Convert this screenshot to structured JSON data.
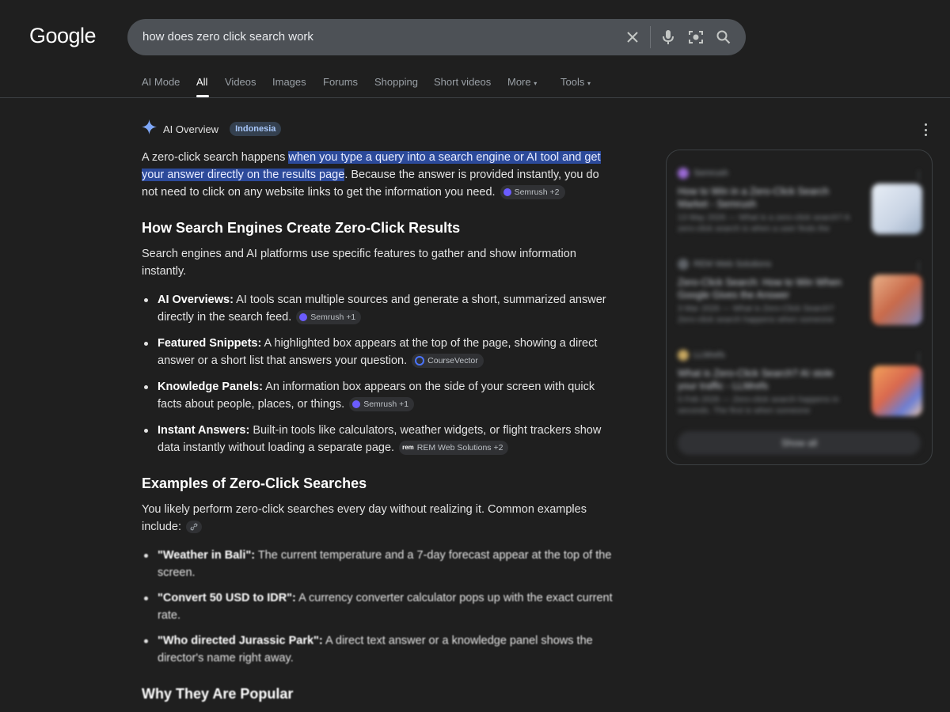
{
  "header": {
    "logo": "Google",
    "search_query": "how does zero click search work"
  },
  "tabs": [
    {
      "label": "AI Mode"
    },
    {
      "label": "All"
    },
    {
      "label": "Videos"
    },
    {
      "label": "Images"
    },
    {
      "label": "Forums"
    },
    {
      "label": "Shopping"
    },
    {
      "label": "Short videos"
    },
    {
      "label": "More"
    },
    {
      "label": "Tools"
    }
  ],
  "ai_overview": {
    "title": "AI Overview",
    "badge": "Indonesia",
    "intro_pre": "A zero-click search happens ",
    "intro_highlight": "when you type a query into a search engine or AI tool and get your answer directly on the results page",
    "intro_post": ". Because the answer is provided instantly, you do not need to click on any website links to get the information you need.",
    "intro_cite": "Semrush +2",
    "section1": {
      "heading": "How Search Engines Create Zero-Click Results",
      "lead": "Search engines and AI platforms use specific features to gather and show information instantly.",
      "items": [
        {
          "term": "AI Overviews:",
          "text": " AI tools scan multiple sources and generate a short, summarized answer directly in the search feed.",
          "cite": "Semrush +1"
        },
        {
          "term": "Featured Snippets:",
          "text": " A highlighted box appears at the top of the page, showing a direct answer or a short list that answers your question.",
          "cite": "CourseVector"
        },
        {
          "term": "Knowledge Panels:",
          "text": " An information box appears on the side of your screen with quick facts about people, places, or things.",
          "cite": "Semrush +1"
        },
        {
          "term": "Instant Answers:",
          "text": " Built-in tools like calculators, weather widgets, or flight trackers show data instantly without loading a separate page.",
          "cite": "REM Web Solutions +2"
        }
      ]
    },
    "section2": {
      "heading": "Examples of Zero-Click Searches",
      "lead": "You likely perform zero-click searches every day without realizing it. Common examples include:",
      "items": [
        {
          "term": "\"Weather in Bali\":",
          "text": " The current temperature and a 7-day forecast appear at the top of the screen."
        },
        {
          "term": "\"Convert 50 USD to IDR\":",
          "text": " A currency converter calculator pops up with the exact current rate."
        },
        {
          "term": "\"Who directed Jurassic Park\":",
          "text": " A direct text answer or a knowledge panel shows the director's name right away."
        }
      ]
    },
    "section3": {
      "heading": "Why They Are Popular"
    }
  },
  "sources": {
    "items": [
      {
        "site": "Semrush",
        "title": "How to Win in a Zero-Click Search Market - Semrush",
        "meta": "13 May 2026 — What is a zero-click search? A zero-click search is when a user finds the"
      },
      {
        "site": "REM Web Solutions",
        "title": "Zero-Click Search: How to Win When Google Gives the Answer",
        "meta": "3 Mar 2026 — What is Zero-Click Search? Zero-click search happens when someone"
      },
      {
        "site": "LLMrefs",
        "title": "What is Zero-Click Search? AI stole your traffic - LLMrefs",
        "meta": "5 Feb 2026 — Zero-click search happens in seconds. The first is when someone"
      }
    ],
    "show_all": "Show all"
  },
  "colors": {
    "background": "#1f1f1f",
    "highlight": "#2c4a9a",
    "badge_text": "#a8c7fa"
  }
}
